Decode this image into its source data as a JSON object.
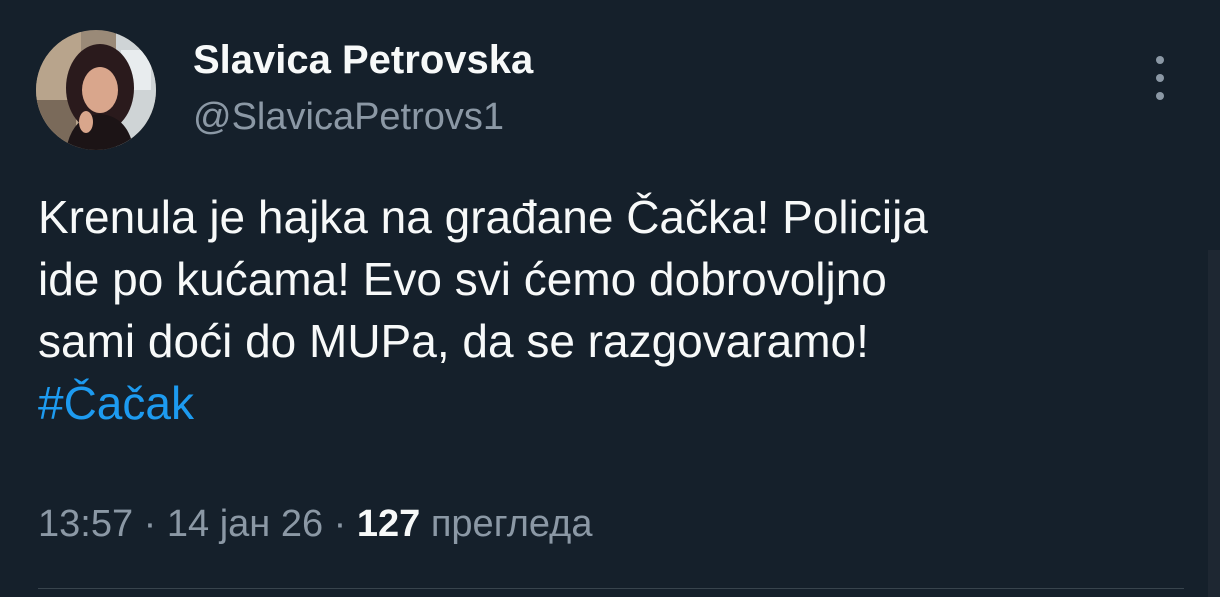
{
  "author": {
    "display_name": "Slavica Petrovska",
    "handle": "@SlavicaPetrovs1",
    "avatar_icon": "profile-photo"
  },
  "tweet": {
    "lines": [
      "Krenula je hajka na građane Čačka! Policija",
      "ide po kućama! Evo svi ćemo dobrovoljno",
      "sami doći do MUPa, da se razgovaramo!"
    ],
    "hashtag": "#Čačak"
  },
  "meta": {
    "time": "13:57",
    "separator": " · ",
    "date": "14 јан 26",
    "views_count": "127",
    "views_label": "прегледа"
  },
  "icons": {
    "more": "more-vertical-icon"
  },
  "colors": {
    "background": "#15202b",
    "text": "#f7f9f9",
    "secondary": "#8b98a5",
    "accent": "#1d9bf0"
  }
}
